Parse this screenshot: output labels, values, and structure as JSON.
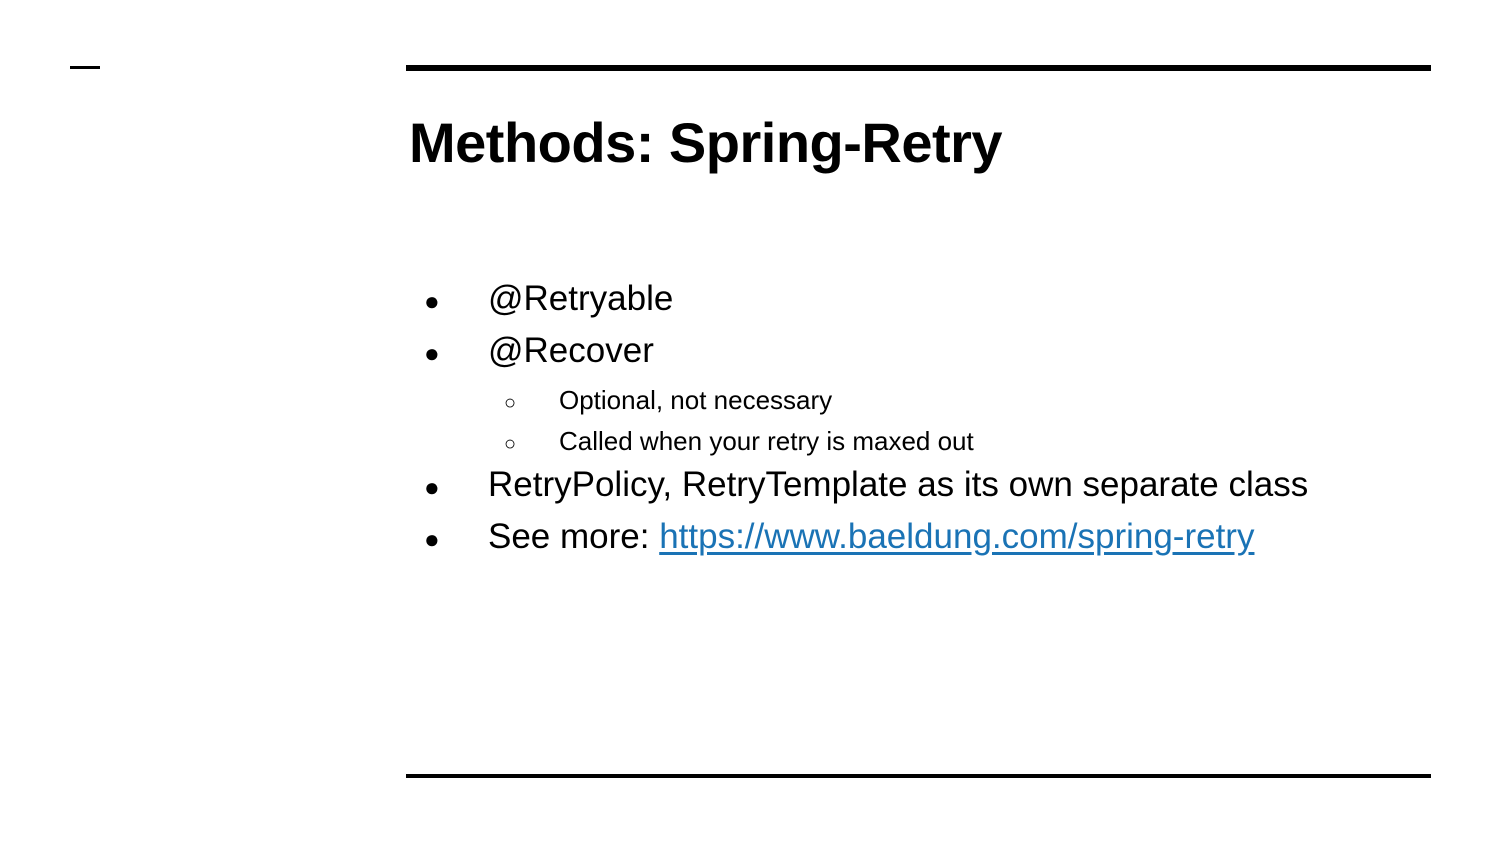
{
  "slide": {
    "title": "Methods: Spring-Retry",
    "bullets": [
      {
        "marker": "●",
        "text": "@Retryable"
      },
      {
        "marker": "●",
        "text": "@Recover",
        "sub": [
          {
            "marker": "○",
            "text": "Optional, not necessary"
          },
          {
            "marker": "○",
            "text": "Called when your retry is maxed out"
          }
        ]
      },
      {
        "marker": "●",
        "text": "RetryPolicy, RetryTemplate as its own separate class"
      },
      {
        "marker": "●",
        "text": "See more: ",
        "link_text": "https://www.baeldung.com/spring-retry"
      }
    ]
  },
  "colors": {
    "text": "#000000",
    "link": "#1a73b5",
    "background": "#ffffff"
  }
}
